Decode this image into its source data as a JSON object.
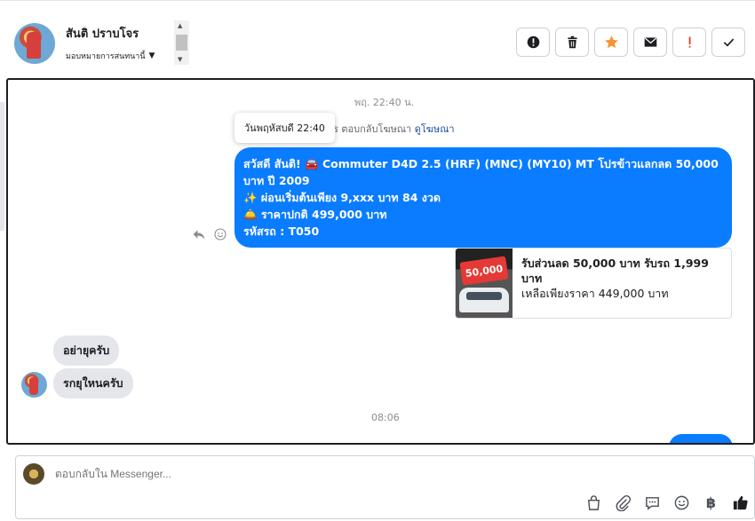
{
  "header": {
    "contact_name": "สันติ ปราบโจร",
    "assign_label": "มอบหมายการสนทนานี้"
  },
  "toolbar": {
    "buttons": [
      {
        "name": "spam-button",
        "icon": "alert-circle-icon"
      },
      {
        "name": "delete-button",
        "icon": "trash-icon"
      },
      {
        "name": "star-button",
        "icon": "star-icon",
        "color": "#f59331"
      },
      {
        "name": "mark-unread-button",
        "icon": "envelope-icon"
      },
      {
        "name": "important-button",
        "icon": "exclamation-icon",
        "color": "#e0452b"
      },
      {
        "name": "done-button",
        "icon": "checkmark-icon"
      }
    ]
  },
  "chat": {
    "timestamp_1": "พฤ. 22:40 น.",
    "tooltip_time": "วันพฤหัสบดี 22:40",
    "ad_reply_prefix": "ร ตอบกลับโฆษณา",
    "ad_reply_link": "ดูโฆษณา",
    "outgoing": {
      "line1": "สวัสดี สันติ! 🚘 Commuter D4D 2.5 (HRF) (MNC) (MY10) MT โปรข้าวแลกลด 50,000 บาท ปี 2009",
      "line2": "✨  ผ่อนเริ่มต้นเพียง 9,xxx บาท  84 งวด",
      "line3": "🛎️  ราคาปกติ 499,000 บาท",
      "line4": "รหัสรถ : T050"
    },
    "ad_card": {
      "badge": "50,000",
      "title": "รับส่วนลด 50,000 บาท รับรถ 1,999 บาท",
      "desc": "เหลือเพียงราคา 449,000 บาท"
    },
    "incoming_1": "อย่ายุครับ",
    "incoming_2": "รกยุใหนครับ",
    "timestamp_2": "08:06"
  },
  "composer": {
    "placeholder": "ตอบกลับใน Messenger..."
  }
}
